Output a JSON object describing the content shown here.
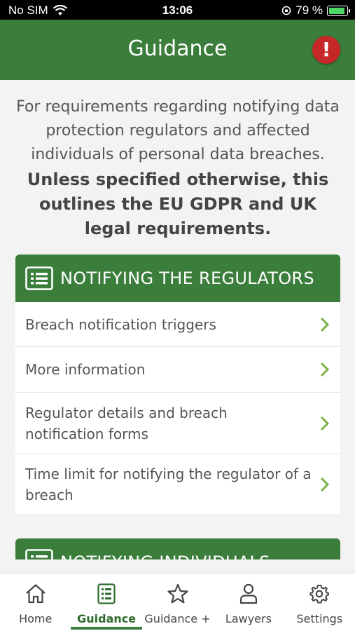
{
  "status_bar": {
    "carrier": "No SIM",
    "time": "13:06",
    "battery": "79 %"
  },
  "header": {
    "title": "Guidance"
  },
  "intro": {
    "text": "For requirements regarding notifying data protection regulators and affected individuals of personal data breaches.",
    "bold_text": "Unless specified otherwise, this outlines the EU GDPR and UK legal requirements."
  },
  "sections": [
    {
      "title": "NOTIFYING THE REGULATORS",
      "items": [
        "Breach notification triggers",
        "More information",
        "Regulator details and breach notification forms",
        "Time limit for notifying the regulator of a breach"
      ]
    },
    {
      "title": "NOTIFYING INDIVIDUALS"
    }
  ],
  "tabs": [
    {
      "label": "Home",
      "icon": "home-icon"
    },
    {
      "label": "Guidance",
      "icon": "list-icon",
      "active": true
    },
    {
      "label": "Guidance +",
      "icon": "star-icon"
    },
    {
      "label": "Lawyers",
      "icon": "person-icon"
    },
    {
      "label": "Settings",
      "icon": "gear-icon"
    }
  ],
  "colors": {
    "brand_green": "#3b7d3b",
    "alert_red": "#c62828",
    "chevron_green": "#7cb342"
  }
}
